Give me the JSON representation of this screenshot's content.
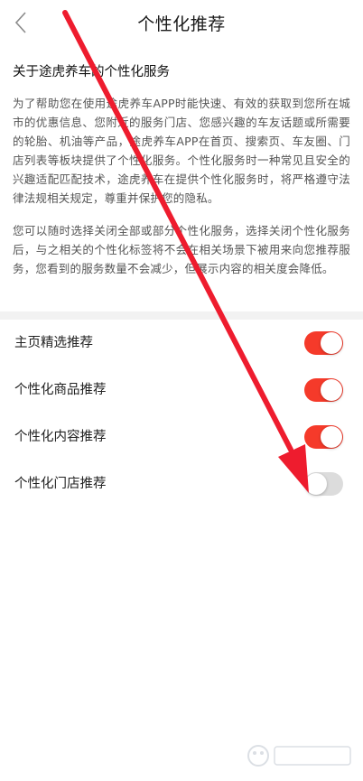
{
  "header": {
    "title": "个性化推荐"
  },
  "content": {
    "section_title": "关于途虎养车的个性化服务",
    "paragraph1": "为了帮助您在使用途虎养车APP时能快速、有效的获取到您所在城市的优惠信息、您附近的服务门店、您感兴趣的车友话题或所需要的轮胎、机油等产品，途虎养车APP在首页、搜索页、车友圈、门店列表等板块提供了个性化服务。个性化服务时一种常见且安全的兴趣适配匹配技术，途虎养车在提供个性化服务时，将严格遵守法律法规相关规定，尊重并保护您的隐私。",
    "paragraph2": "您可以随时选择关闭全部或部分个性化服务，选择关闭个性化服务后，与之相关的个性化标签将不会在相关场景下被用来向您推荐服务，您看到的服务数量不会减少，但展示内容的相关度会降低。"
  },
  "toggles": [
    {
      "label": "主页精选推荐",
      "on": true
    },
    {
      "label": "个性化商品推荐",
      "on": true
    },
    {
      "label": "个性化内容推荐",
      "on": true
    },
    {
      "label": "个性化门店推荐",
      "on": false
    }
  ],
  "colors": {
    "accent": "#f53a2a",
    "toggle_off": "#dcdcdc",
    "annotation_arrow": "#ee1c2e"
  }
}
